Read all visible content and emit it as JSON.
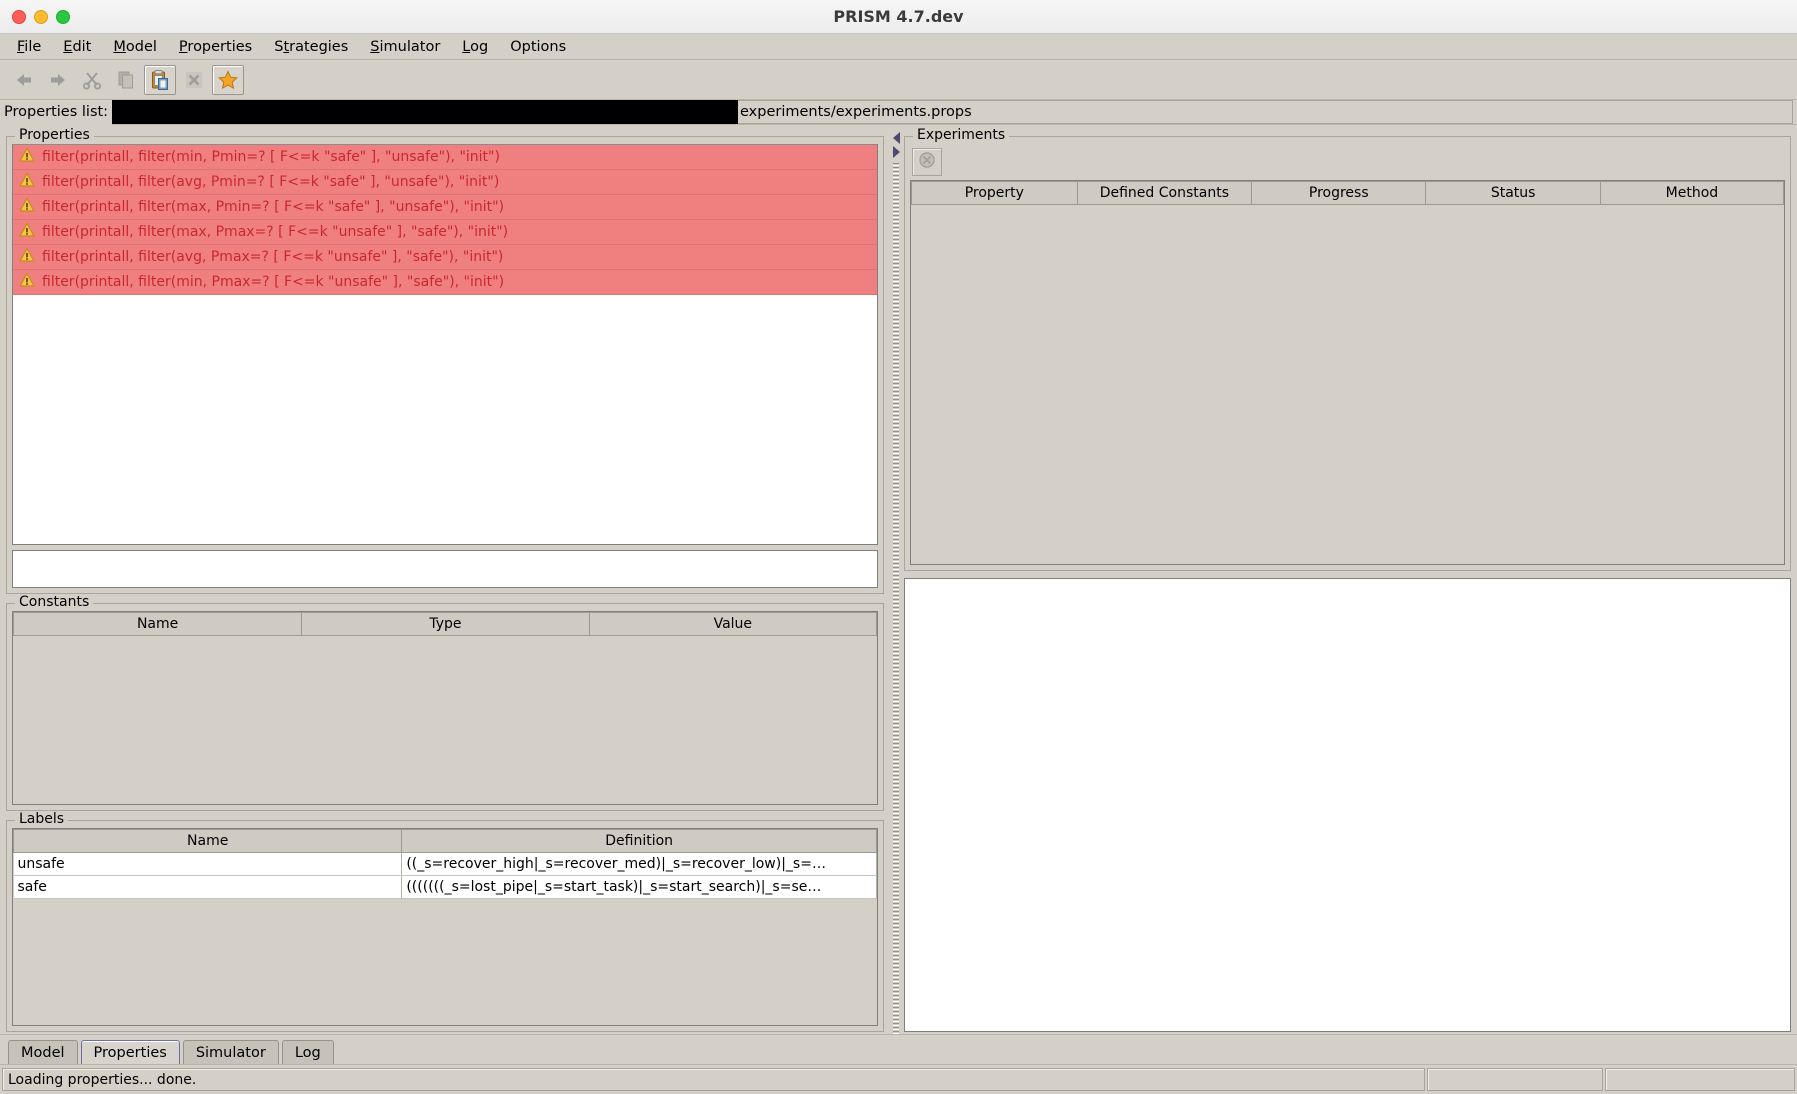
{
  "window": {
    "title": "PRISM 4.7.dev"
  },
  "menubar": {
    "items": [
      {
        "label": "File",
        "mnemonic_index": 0
      },
      {
        "label": "Edit",
        "mnemonic_index": 0
      },
      {
        "label": "Model",
        "mnemonic_index": 0
      },
      {
        "label": "Properties",
        "mnemonic_index": 0
      },
      {
        "label": "Strategies",
        "mnemonic_index": 1
      },
      {
        "label": "Simulator",
        "mnemonic_index": 0
      },
      {
        "label": "Log",
        "mnemonic_index": 0
      },
      {
        "label": "Options",
        "mnemonic_index": -1
      }
    ]
  },
  "toolbar": {
    "buttons": [
      {
        "name": "undo-icon",
        "enabled": false
      },
      {
        "name": "redo-icon",
        "enabled": false
      },
      {
        "name": "cut-icon",
        "enabled": false
      },
      {
        "name": "copy-icon",
        "enabled": false
      },
      {
        "name": "paste-icon",
        "enabled": true
      },
      {
        "name": "delete-icon",
        "enabled": false
      },
      {
        "name": "add-property-icon",
        "enabled": true
      }
    ]
  },
  "pathbar": {
    "label": "Properties list:",
    "redacted": true,
    "value": "experiments/experiments.props"
  },
  "properties_panel": {
    "title": "Properties",
    "items": [
      {
        "icon": "warning-icon",
        "text": "filter(printall, filter(min, Pmin=? [ F<=k \"safe\" ], \"unsafe\"), \"init\")"
      },
      {
        "icon": "warning-icon",
        "text": "filter(printall, filter(avg, Pmin=? [ F<=k \"safe\" ], \"unsafe\"), \"init\")"
      },
      {
        "icon": "warning-icon",
        "text": "filter(printall, filter(max, Pmin=? [ F<=k \"safe\" ], \"unsafe\"), \"init\")"
      },
      {
        "icon": "warning-icon",
        "text": "filter(printall, filter(max, Pmax=? [ F<=k \"unsafe\" ], \"safe\"), \"init\")"
      },
      {
        "icon": "warning-icon",
        "text": "filter(printall, filter(avg, Pmax=? [ F<=k \"unsafe\" ], \"safe\"), \"init\")"
      },
      {
        "icon": "warning-icon",
        "text": "filter(printall, filter(min, Pmax=? [ F<=k \"unsafe\" ], \"safe\"), \"init\")"
      }
    ],
    "comment_value": ""
  },
  "constants_panel": {
    "title": "Constants",
    "columns": [
      "Name",
      "Type",
      "Value"
    ],
    "rows": []
  },
  "labels_panel": {
    "title": "Labels",
    "columns": [
      "Name",
      "Definition"
    ],
    "rows": [
      {
        "name": "unsafe",
        "definition": "((_s=recover_high|_s=recover_med)|_s=recover_low)|_s=…"
      },
      {
        "name": "safe",
        "definition": "(((((((_s=lost_pipe|_s=start_task)|_s=start_search)|_s=se…"
      }
    ]
  },
  "experiments_panel": {
    "title": "Experiments",
    "stop_button": {
      "name": "stop-experiment-button",
      "enabled": false
    },
    "columns": [
      "Property",
      "Defined Constants",
      "Progress",
      "Status",
      "Method"
    ],
    "rows": []
  },
  "log_panel": {
    "content": ""
  },
  "tabs": [
    {
      "label": "Model",
      "active": false
    },
    {
      "label": "Properties",
      "active": true
    },
    {
      "label": "Simulator",
      "active": false
    },
    {
      "label": "Log",
      "active": false
    }
  ],
  "statusbar": {
    "message": "Loading properties... done."
  },
  "colors": {
    "property_row_background": "#f08080",
    "property_row_text": "#c8282d",
    "warning_icon": "#f5a623",
    "window_background": "#d4d0c8",
    "accent_tab_border": "#6f6fa0"
  }
}
